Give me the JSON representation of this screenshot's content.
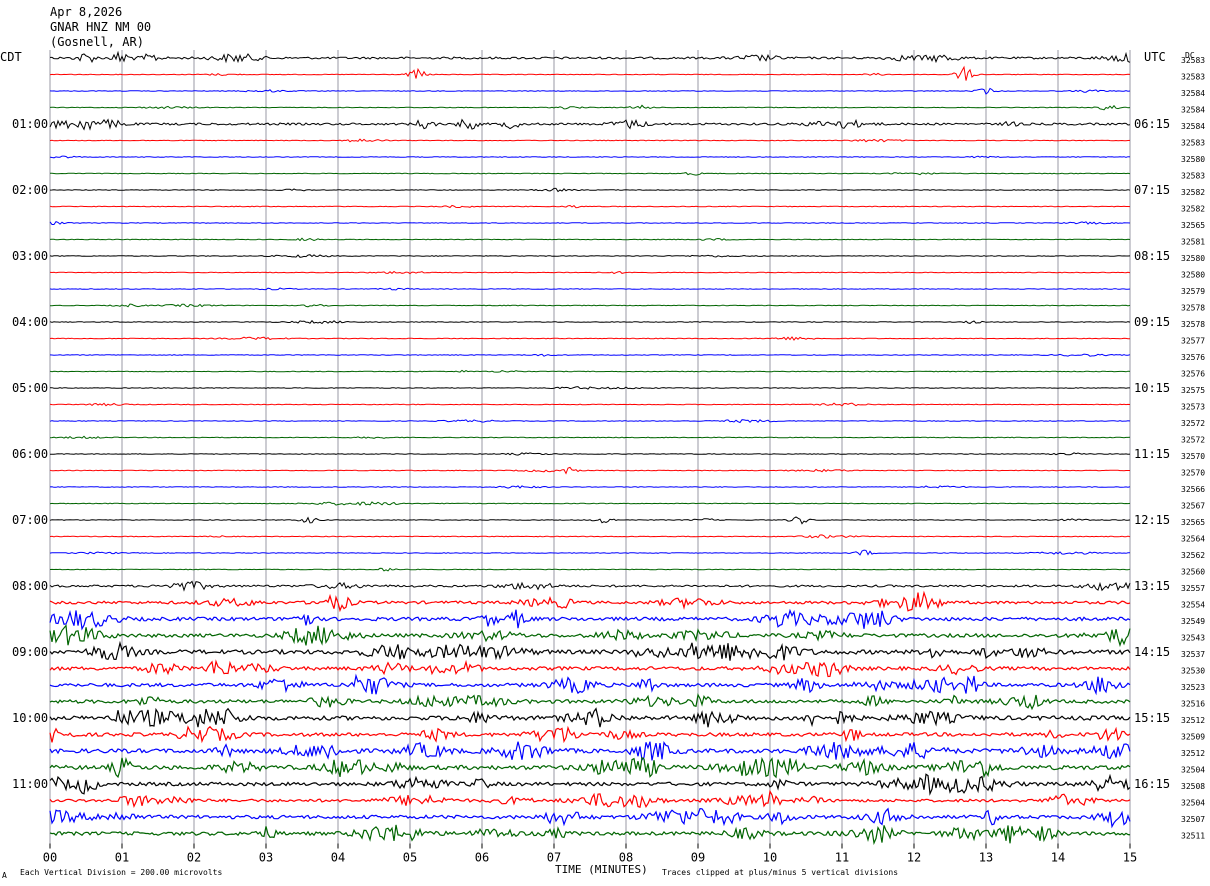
{
  "header": {
    "date": "Apr 8,2026",
    "station": "GNAR HNZ NM 00",
    "location": "(Gosnell, AR)"
  },
  "labels": {
    "left_zone": "CDT",
    "right_zone": "UTC",
    "dc_header": "DC",
    "xlabel": "TIME (MINUTES)",
    "footer_left": "Each Vertical Division =  200.00 microvolts",
    "footer_right": "Traces clipped at plus/minus 5 vertical divisions",
    "corner_mark": "A"
  },
  "chart_data": {
    "type": "line",
    "title": "",
    "xlabel": "TIME (MINUTES)",
    "ylabel": "",
    "xlim": [
      0,
      15
    ],
    "x_ticks": [
      "00",
      "01",
      "02",
      "03",
      "04",
      "05",
      "06",
      "07",
      "08",
      "09",
      "10",
      "11",
      "12",
      "13",
      "14",
      "15"
    ],
    "rows": 48,
    "rows_per_hour": 4,
    "series_colors": [
      "#000000",
      "#ff0000",
      "#0000ff",
      "#006400"
    ],
    "left_time_labels": [
      "01:00",
      "02:00",
      "03:00",
      "04:00",
      "05:00",
      "06:00",
      "07:00",
      "08:00",
      "09:00",
      "10:00",
      "11:00"
    ],
    "right_time_labels": [
      "06:15",
      "07:15",
      "08:15",
      "09:15",
      "10:15",
      "11:15",
      "12:15",
      "13:15",
      "14:15",
      "15:15",
      "16:15"
    ],
    "dc_values": [
      "32583",
      "32583",
      "32584",
      "32584",
      "32584",
      "32583",
      "32580",
      "32583",
      "32582",
      "32582",
      "32565",
      "32581",
      "32580",
      "32580",
      "32579",
      "32578",
      "32578",
      "32577",
      "32576",
      "32576",
      "32575",
      "32573",
      "32572",
      "32572",
      "32570",
      "32570",
      "32566",
      "32567",
      "32565",
      "32564",
      "32562",
      "32560",
      "32557",
      "32554",
      "32549",
      "32543",
      "32537",
      "32530",
      "32523",
      "32516",
      "32512",
      "32509",
      "32512",
      "32504",
      "32508",
      "32504",
      "32507",
      "32511"
    ],
    "amplitude_levels": [
      3,
      1,
      1,
      1,
      3,
      1,
      1,
      1,
      1,
      1,
      1,
      1,
      1,
      1,
      1,
      1,
      1,
      1,
      1,
      1,
      1,
      1,
      1,
      1,
      1,
      1,
      1,
      1,
      1,
      1,
      1,
      1,
      3,
      4,
      5,
      5,
      6,
      5,
      5,
      5,
      6,
      5,
      6,
      6,
      5,
      4,
      5,
      5
    ],
    "events": [
      {
        "row": 0,
        "minute": 0.5,
        "amp": 5
      },
      {
        "row": 0,
        "minute": 1.0,
        "amp": 7
      },
      {
        "row": 0,
        "minute": 1.4,
        "amp": 4
      },
      {
        "row": 1,
        "minute": 5.1,
        "amp": 5
      },
      {
        "row": 1,
        "minute": 12.7,
        "amp": 7
      },
      {
        "row": 2,
        "minute": 13.0,
        "amp": 3
      },
      {
        "row": 3,
        "minute": 8.2,
        "amp": 3
      },
      {
        "row": 3,
        "minute": 14.7,
        "amp": 3
      },
      {
        "row": 4,
        "minute": 0.5,
        "amp": 4
      },
      {
        "row": 4,
        "minute": 5.2,
        "amp": 5
      },
      {
        "row": 4,
        "minute": 5.8,
        "amp": 6
      },
      {
        "row": 4,
        "minute": 6.4,
        "amp": 4
      },
      {
        "row": 15,
        "minute": 3.7,
        "amp": 3
      },
      {
        "row": 25,
        "minute": 7.2,
        "amp": 3
      },
      {
        "row": 28,
        "minute": 3.6,
        "amp": 3
      },
      {
        "row": 28,
        "minute": 7.7,
        "amp": 3
      },
      {
        "row": 28,
        "minute": 10.4,
        "amp": 4
      },
      {
        "row": 30,
        "minute": 11.3,
        "amp": 3
      },
      {
        "row": 34,
        "minute": 6.5,
        "amp": 8
      },
      {
        "row": 34,
        "minute": 6.1,
        "amp": 6
      },
      {
        "row": 35,
        "minute": 14.9,
        "amp": 7
      },
      {
        "row": 36,
        "minute": 8.5,
        "amp": 6
      },
      {
        "row": 36,
        "minute": 13.0,
        "amp": 5
      },
      {
        "row": 37,
        "minute": 2.4,
        "amp": 6
      },
      {
        "row": 38,
        "minute": 12.8,
        "amp": 10
      },
      {
        "row": 38,
        "minute": 8.3,
        "amp": 8
      },
      {
        "row": 38,
        "minute": 14.6,
        "amp": 6
      },
      {
        "row": 40,
        "minute": 7.6,
        "amp": 9
      },
      {
        "row": 40,
        "minute": 1.0,
        "amp": 7
      },
      {
        "row": 42,
        "minute": 11.2,
        "amp": 10
      },
      {
        "row": 42,
        "minute": 3.9,
        "amp": 8
      },
      {
        "row": 43,
        "minute": 1.0,
        "amp": 10
      },
      {
        "row": 44,
        "minute": 12.2,
        "amp": 8
      },
      {
        "row": 44,
        "minute": 6.0,
        "amp": 5
      },
      {
        "row": 45,
        "minute": 14.0,
        "amp": 9
      },
      {
        "row": 45,
        "minute": 10.0,
        "amp": 6
      },
      {
        "row": 46,
        "minute": 13.1,
        "amp": 7
      },
      {
        "row": 47,
        "minute": 3.0,
        "amp": 6
      },
      {
        "row": 47,
        "minute": 11.5,
        "amp": 6
      }
    ]
  }
}
